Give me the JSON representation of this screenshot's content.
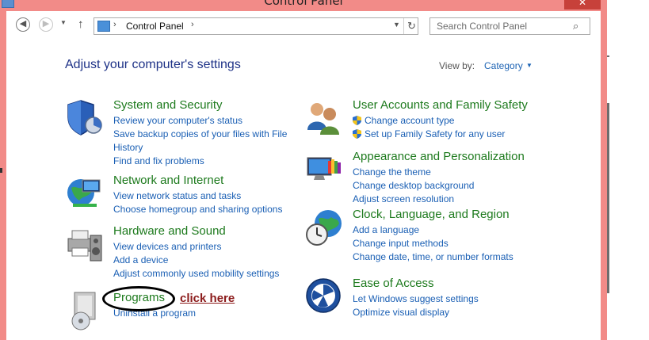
{
  "window": {
    "title": "Control Panel",
    "close_label": "✕"
  },
  "nav": {
    "back_icon": "◀",
    "forward_icon": "▶",
    "up_icon": "↑",
    "address": {
      "crumbs": [
        "Control Panel"
      ],
      "separator": "›"
    },
    "search_placeholder": "Search Control Panel"
  },
  "main": {
    "heading": "Adjust your computer's settings",
    "view_by_label": "View by:",
    "view_by_value": "Category"
  },
  "categories": [
    {
      "title": "System and Security",
      "icon": "shield-icon",
      "links": [
        "Review your computer's status",
        "Save backup copies of your files with File",
        "History",
        "Find and fix problems"
      ]
    },
    {
      "title": "Network and Internet",
      "icon": "network-globe-icon",
      "links": [
        "View network status and tasks",
        "Choose homegroup and sharing options"
      ]
    },
    {
      "title": "Hardware and Sound",
      "icon": "printer-speaker-icon",
      "links": [
        "View devices and printers",
        "Add a device",
        "Adjust commonly used mobility settings"
      ]
    },
    {
      "title": "Programs",
      "icon": "programs-icon",
      "links": [
        "Uninstall a program"
      ]
    },
    {
      "title": "User Accounts and Family Safety",
      "icon": "users-icon",
      "links": [
        "Change account type",
        "Set up Family Safety for any user"
      ]
    },
    {
      "title": "Appearance and Personalization",
      "icon": "monitor-palette-icon",
      "links": [
        "Change the theme",
        "Change desktop background",
        "Adjust screen resolution"
      ]
    },
    {
      "title": "Clock, Language, and Region",
      "icon": "clock-globe-icon",
      "links": [
        "Add a language",
        "Change input methods",
        "Change date, time, or number formats"
      ]
    },
    {
      "title": "Ease of Access",
      "icon": "ease-of-access-icon",
      "links": [
        "Let Windows suggest settings",
        "Optimize visual display"
      ]
    }
  ],
  "annotation": {
    "click_here": "click here"
  },
  "colors": {
    "window_frame": "#f28b88",
    "category_title": "#1d7a1d",
    "link": "#1a5fb4",
    "heading": "#1e3287",
    "annotation": "#8b1a1a"
  }
}
